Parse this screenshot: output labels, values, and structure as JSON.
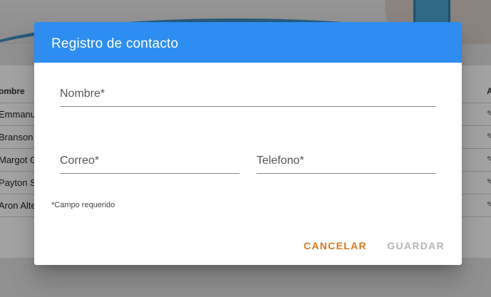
{
  "background": {
    "table": {
      "header": {
        "name": "ombre",
        "actions": "A"
      },
      "rows": [
        {
          "name": "Emmanu",
          "action": "✎"
        },
        {
          "name": "Branson",
          "action": "✎"
        },
        {
          "name": "Margot G",
          "action": "✎"
        },
        {
          "name": "Payton S",
          "action": "✎"
        },
        {
          "name": "Aron Alte",
          "action": "✎"
        }
      ]
    }
  },
  "dialog": {
    "title": "Registro de contacto",
    "fields": {
      "nombre": {
        "placeholder": "Nombre*",
        "value": ""
      },
      "correo": {
        "placeholder": "Correo*",
        "value": ""
      },
      "telefono": {
        "placeholder": "Telefono*",
        "value": ""
      }
    },
    "hint": "*Campo requerido",
    "buttons": {
      "cancel": "CANCELAR",
      "save": "GUARDAR"
    }
  },
  "colors": {
    "header": "#2d8df0",
    "cancel": "#d9781c",
    "save_disabled": "#b5b5b5"
  }
}
